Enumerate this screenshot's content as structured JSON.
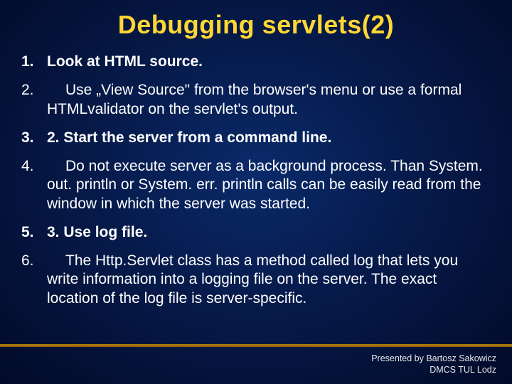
{
  "title": "Debugging servlets(2)",
  "items": [
    {
      "num": "1.",
      "bold": true,
      "text": "Look at HTML source."
    },
    {
      "num": "2.",
      "bold": false,
      "text": "Use „View Source\" from the browser's menu or use a formal HTMLvalidator on the servlet's output."
    },
    {
      "num": "3.",
      "bold": true,
      "text": "2. Start the server from a command line."
    },
    {
      "num": "4.",
      "bold": false,
      "text": "Do not execute server as a background process. Than System. out. println or System. err. println calls can be easily read from the window in which the server was started."
    },
    {
      "num": "5.",
      "bold": true,
      "text": "3. Use log file."
    },
    {
      "num": "6.",
      "bold": false,
      "text": "The Http.Servlet class has a method called log that lets you write information into a logging file on the server. The exact location of the log file is server-specific."
    }
  ],
  "footer": {
    "line1": "Presented by Bartosz  Sakowicz",
    "line2": "DMCS TUL Lodz"
  }
}
